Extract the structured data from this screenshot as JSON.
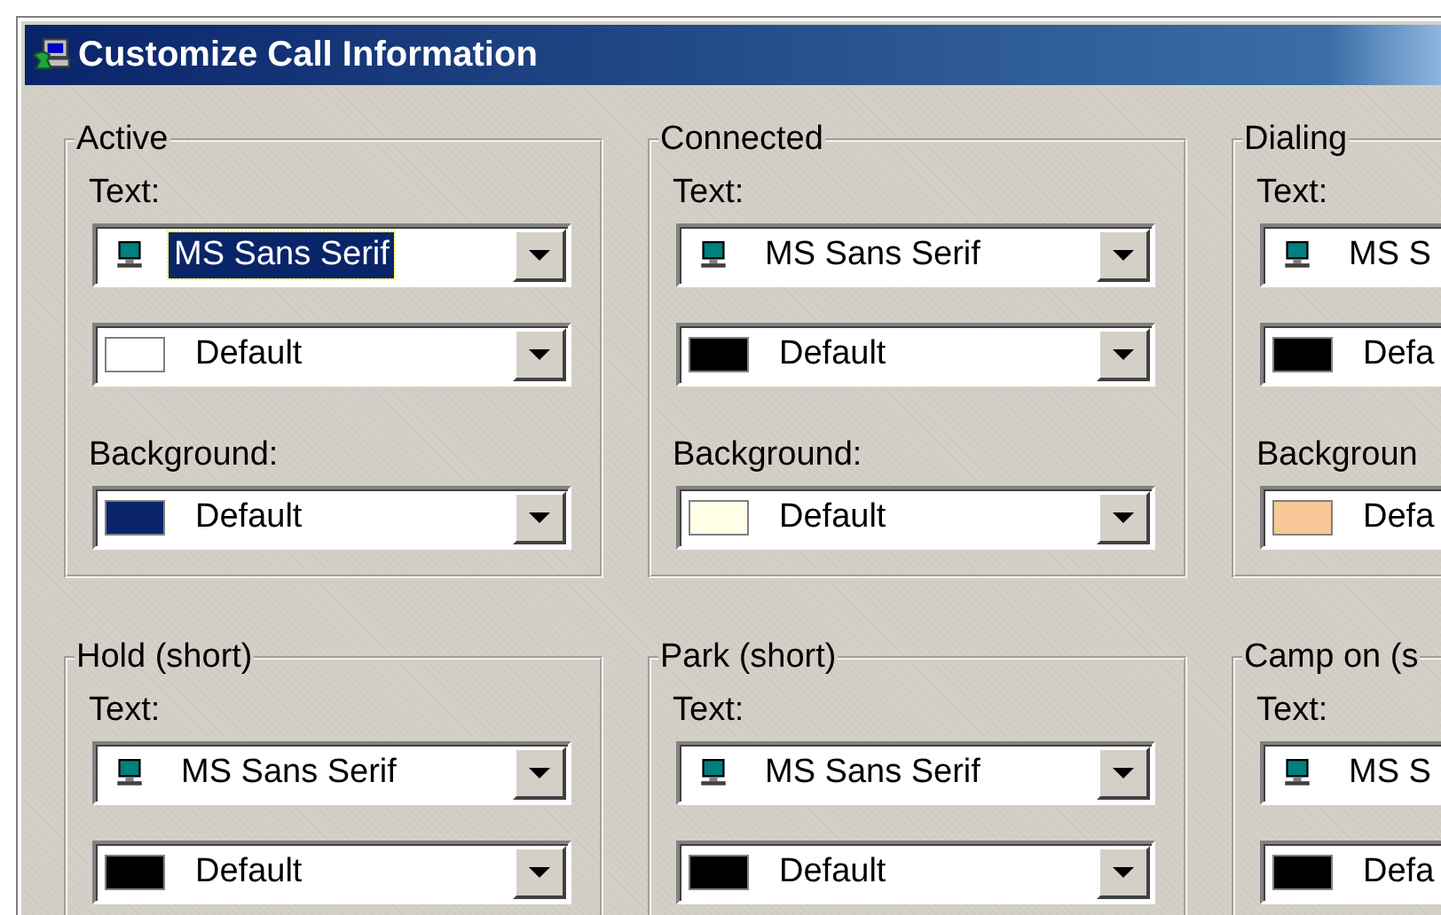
{
  "window": {
    "title": "Customize Call Information"
  },
  "groups": [
    {
      "title": "Active",
      "text_label": "Text:",
      "font_combo": {
        "value": "MS Sans Serif",
        "focused": true
      },
      "color_combo": {
        "value": "Default",
        "color": "#ffffff"
      },
      "background_label": "Background:",
      "background_combo": {
        "value": "Default",
        "color": "#0a246a"
      }
    },
    {
      "title": "Connected",
      "text_label": "Text:",
      "font_combo": {
        "value": "MS Sans Serif",
        "focused": false
      },
      "color_combo": {
        "value": "Default",
        "color": "#000000"
      },
      "background_label": "Background:",
      "background_combo": {
        "value": "Default",
        "color": "#ffffe8"
      }
    },
    {
      "title": "Dialing",
      "text_label": "Text:",
      "font_combo": {
        "value": "MS S",
        "focused": false
      },
      "color_combo": {
        "value": "Defa",
        "color": "#000000"
      },
      "background_label": "Backgroun",
      "background_combo": {
        "value": "Defa",
        "color": "#f8c898"
      }
    },
    {
      "title": "Hold (short)",
      "text_label": "Text:",
      "font_combo": {
        "value": "MS Sans Serif",
        "focused": false
      },
      "color_combo": {
        "value": "Default",
        "color": "#000000"
      }
    },
    {
      "title": "Park (short)",
      "text_label": "Text:",
      "font_combo": {
        "value": "MS Sans Serif",
        "focused": false
      },
      "color_combo": {
        "value": "Default",
        "color": "#000000"
      }
    },
    {
      "title": "Camp on (s",
      "text_label": "Text:",
      "font_combo": {
        "value": "MS S",
        "focused": false
      },
      "color_combo": {
        "value": "Defa",
        "color": "#000000"
      }
    }
  ]
}
